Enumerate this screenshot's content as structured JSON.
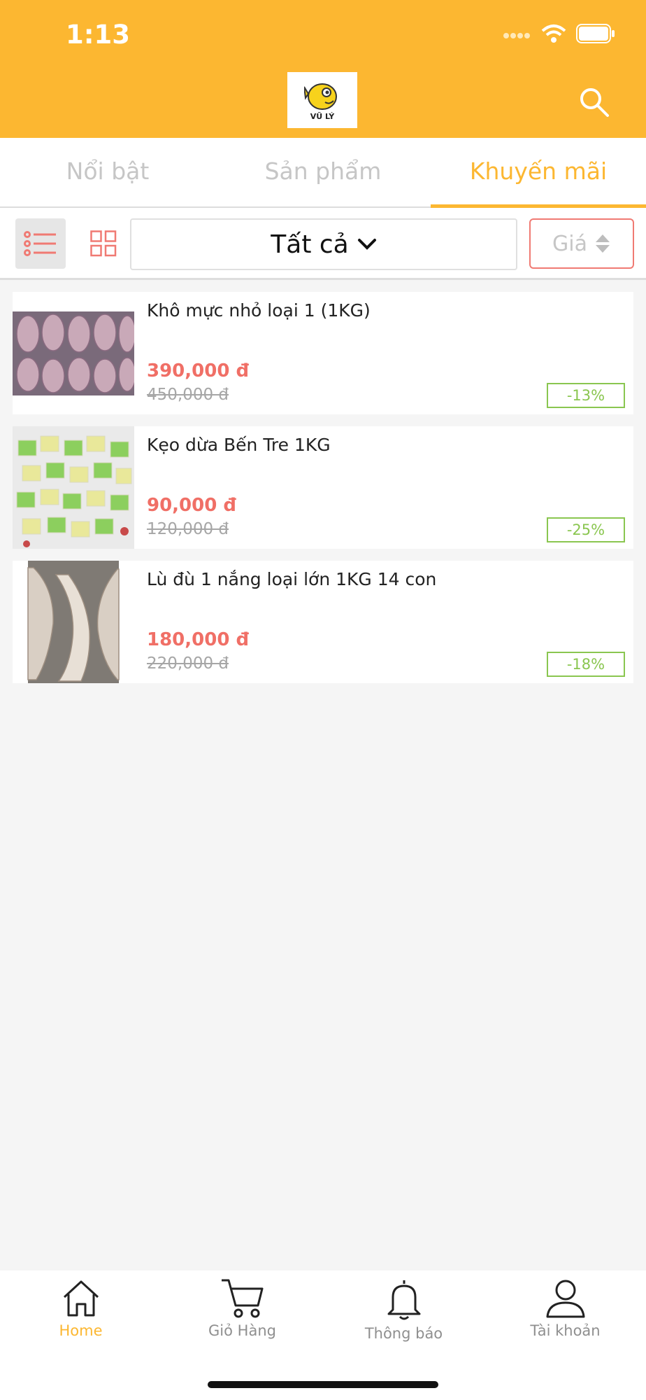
{
  "status_bar": {
    "time": "1:13"
  },
  "header": {
    "logo_text": "VŨ LÝ",
    "search_icon": "search-icon"
  },
  "tabs": [
    {
      "label": "Nổi bật",
      "active": false
    },
    {
      "label": "Sản phẩm",
      "active": false
    },
    {
      "label": "Khuyến mãi",
      "active": true
    }
  ],
  "filter": {
    "category_label": "Tất cả",
    "sort_label": "Giá",
    "view_mode": "list",
    "list_icon": "list-view-icon",
    "grid_icon": "grid-view-icon"
  },
  "products": [
    {
      "name": "Khô mực nhỏ loại 1 (1KG)",
      "price": "390,000 đ",
      "old_price": "450,000 đ",
      "discount": "-13%"
    },
    {
      "name": "Kẹo dừa Bến Tre 1KG",
      "price": "90,000 đ",
      "old_price": "120,000 đ",
      "discount": "-25%"
    },
    {
      "name": "Lù đù 1 nắng loại lớn 1KG 14 con",
      "price": "180,000 đ",
      "old_price": "220,000 đ",
      "discount": "-18%"
    }
  ],
  "bottom_nav": [
    {
      "label": "Home",
      "icon": "home-icon",
      "active": true
    },
    {
      "label": "Giỏ Hàng",
      "icon": "cart-icon",
      "active": false
    },
    {
      "label": "Thông báo",
      "icon": "bell-icon",
      "active": false
    },
    {
      "label": "Tài khoản",
      "icon": "user-icon",
      "active": false
    }
  ],
  "colors": {
    "brand": "#fcb731",
    "price": "#f06f66",
    "discount": "#8ac650"
  }
}
